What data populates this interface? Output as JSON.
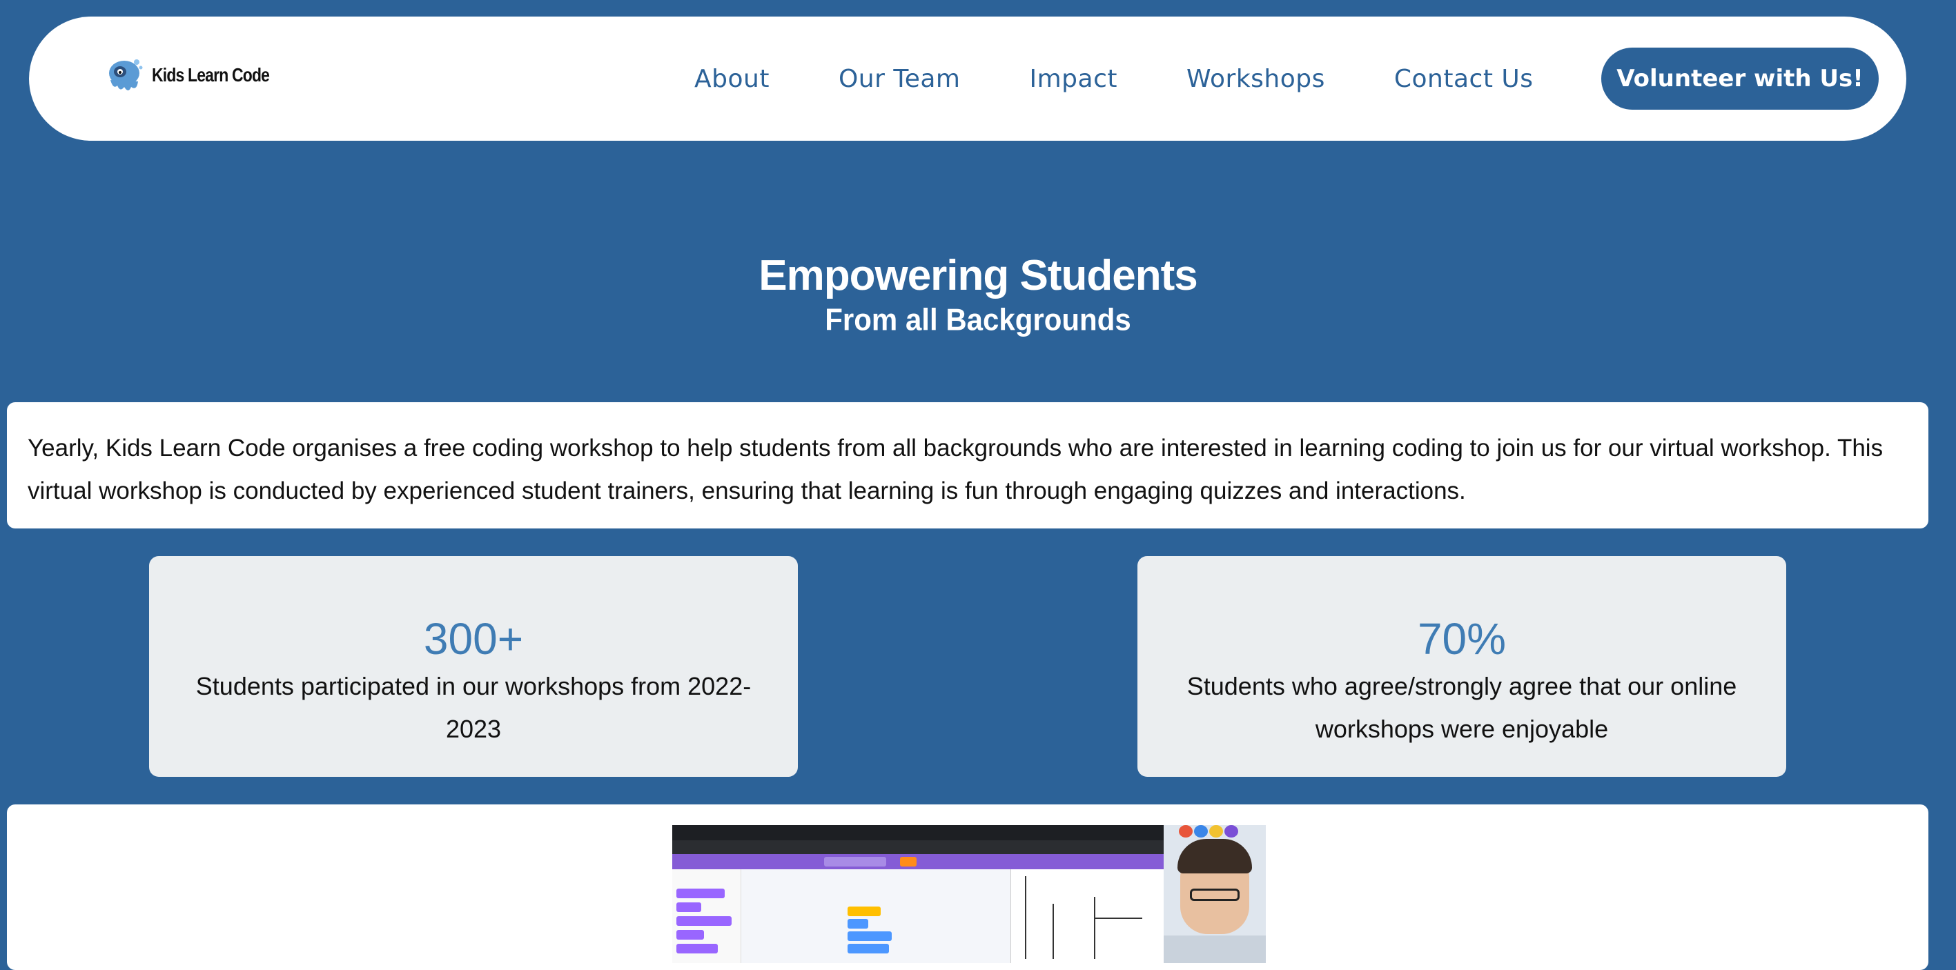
{
  "brand": {
    "name": "Kids Learn Code"
  },
  "nav": {
    "items": [
      {
        "label": "About"
      },
      {
        "label": "Our Team"
      },
      {
        "label": "Impact"
      },
      {
        "label": "Workshops"
      },
      {
        "label": "Contact Us"
      }
    ],
    "cta_label": "Volunteer with Us!"
  },
  "hero": {
    "title": "Empowering Students",
    "subtitle": "From all Backgrounds"
  },
  "intro": {
    "text": "Yearly, Kids Learn Code organises a free coding workshop to help students from all backgrounds who are interested in learning coding to join us for our virtual workshop. This virtual workshop is conducted by experienced student trainers, ensuring that learning is fun through engaging quizzes and interactions."
  },
  "stats": [
    {
      "value": "300+",
      "description": "Students participated in our workshops from 2022-2023"
    },
    {
      "value": "70%",
      "description": "Students who agree/strongly agree that our online workshops were enjoyable"
    }
  ],
  "colors": {
    "background": "#2c6298",
    "accent": "#3f7cb4",
    "card": "#ebeef0"
  }
}
